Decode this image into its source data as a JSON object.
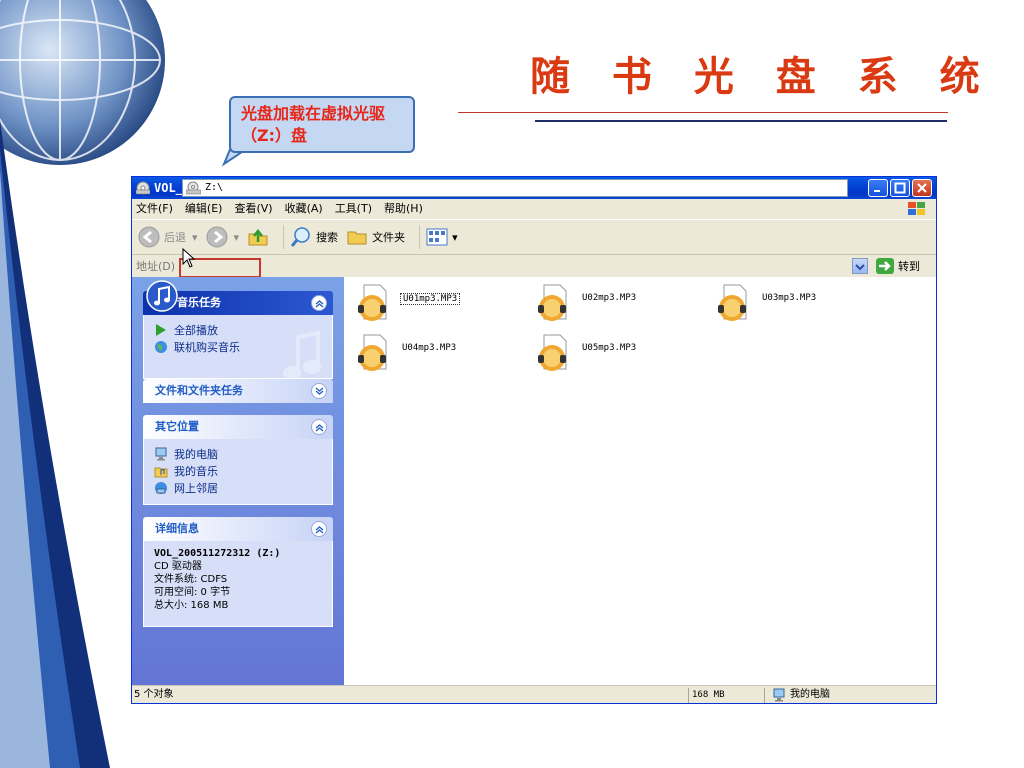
{
  "slide": {
    "title": "随 书 光 盘 系 统",
    "callout": "光盘加载在虚拟光驱（Z:）盘"
  },
  "window": {
    "title": "VOL_200511272312 (Z:)",
    "menu": [
      "文件(F)",
      "编辑(E)",
      "查看(V)",
      "收藏(A)",
      "工具(T)",
      "帮助(H)"
    ],
    "toolbar": {
      "back": "后退",
      "search": "搜索",
      "folders": "文件夹"
    },
    "address": {
      "label": "地址(D)",
      "value": "Z:\\",
      "go": "转到"
    }
  },
  "tasks": {
    "music": {
      "title": "音乐任务",
      "items": [
        "全部播放",
        "联机购买音乐"
      ]
    },
    "file_tasks": {
      "title": "文件和文件夹任务"
    },
    "other_places": {
      "title": "其它位置",
      "items": [
        "我的电脑",
        "我的音乐",
        "网上邻居"
      ]
    },
    "details": {
      "title": "详细信息",
      "name": "VOL_200511272312 (Z:)",
      "type": "CD 驱动器",
      "filesystem": "文件系统: CDFS",
      "free": "可用空间: 0 字节",
      "total": "总大小: 168 MB"
    }
  },
  "files": [
    "U01mp3.MP3",
    "U02mp3.MP3",
    "U03mp3.MP3",
    "U04mp3.MP3",
    "U05mp3.MP3"
  ],
  "status": {
    "count": "5 个对象",
    "size": "168 MB",
    "location": "我的电脑"
  },
  "colors": {
    "title_red": "#d93a12",
    "xp_blue": "#0440d0",
    "task_pane": "#6375d6"
  }
}
